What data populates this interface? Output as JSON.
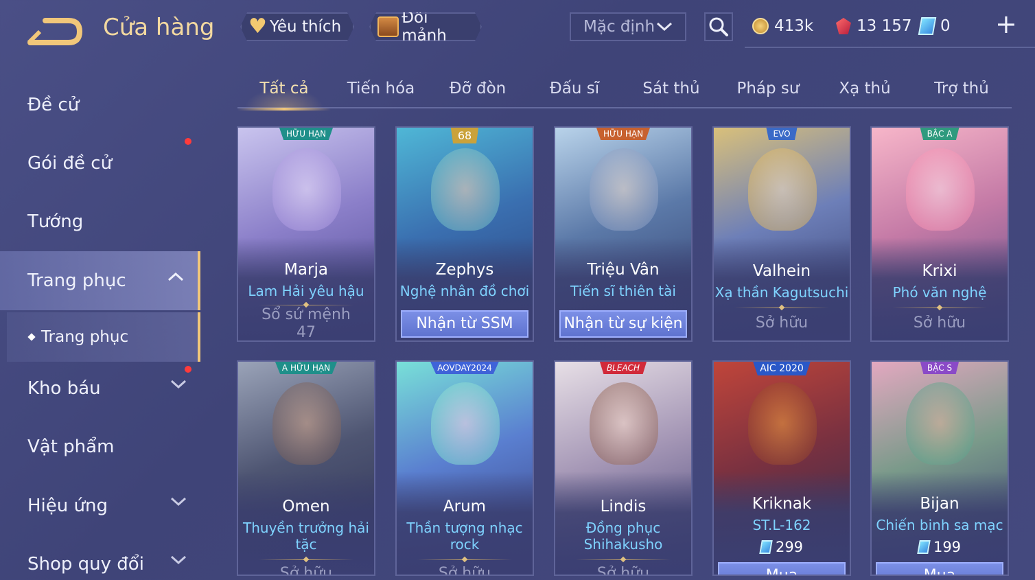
{
  "header": {
    "title": "Cửa hàng",
    "favorites_label": "Yêu thích",
    "shards_label": "Đổi mảnh",
    "sort_value": "Mặc định",
    "currencies": {
      "gold": "413k",
      "ruby": "13 157",
      "voucher": "0"
    }
  },
  "sidebar": {
    "items": [
      {
        "label": "Đề cử"
      },
      {
        "label": "Gói đề cử"
      },
      {
        "label": "Tướng"
      },
      {
        "label": "Trang phục"
      },
      {
        "label": "Kho báu"
      },
      {
        "label": "Vật phẩm"
      },
      {
        "label": "Hiệu ứng"
      },
      {
        "label": "Shop quy đổi"
      }
    ],
    "sub_item": "Trang phục"
  },
  "tabs": [
    "Tất cả",
    "Tiến hóa",
    "Đỡ đòn",
    "Đấu sĩ",
    "Sát thủ",
    "Pháp sư",
    "Xạ thủ",
    "Trợ thủ"
  ],
  "cards": [
    {
      "hero": "Marja",
      "skin": "Lam Hải yêu hậu",
      "badge": "HỮU HẠN",
      "status": "Sổ sứ mệnh",
      "status2": "47"
    },
    {
      "hero": "Zephys",
      "skin": "Nghệ nhân đồ chơi",
      "badge": "68",
      "action": "Nhận từ SSM"
    },
    {
      "hero": "Triệu Vân",
      "skin": "Tiến sĩ thiên tài",
      "badge": "HỮU HẠN",
      "action": "Nhận từ sự kiện"
    },
    {
      "hero": "Valhein",
      "skin": "Xạ thần Kagutsuchi",
      "badge": "EVO",
      "status": "Sở hữu"
    },
    {
      "hero": "Krixi",
      "skin": "Phó văn nghệ",
      "badge": "BẬC A",
      "status": "Sở hữu"
    },
    {
      "hero": "Omen",
      "skin": "Thuyền trưởng hải tặc",
      "badge": "A HỮU HẠN",
      "status": "Sở hữu"
    },
    {
      "hero": "Arum",
      "skin": "Thần tượng nhạc rock",
      "badge": "AOVDAY2024",
      "status": "Sở hữu"
    },
    {
      "hero": "Lindis",
      "skin": "Đồng phục Shihakusho",
      "badge": "BLEACH",
      "status": "Sở hữu"
    },
    {
      "hero": "Kriknak",
      "skin": "ST.L-162",
      "badge": "AIC 2020",
      "price": "299",
      "action": "Mua"
    },
    {
      "hero": "Bijan",
      "skin": "Chiến binh sa mạc",
      "badge": "BẬC S",
      "price": "199",
      "action": "Mua"
    }
  ],
  "icons": {
    "back": "back-arrow-icon",
    "favorite": "heart-icon",
    "shard": "chest-icon",
    "search": "search-icon",
    "gold": "gold-coin-icon",
    "ruby": "ruby-gem-icon",
    "voucher": "voucher-icon",
    "add": "plus-icon"
  },
  "colors": {
    "accent_gold": "#f1c77a",
    "skin_name": "#7fd3ff",
    "background": "#44497e",
    "notification": "#ff3b3b"
  }
}
